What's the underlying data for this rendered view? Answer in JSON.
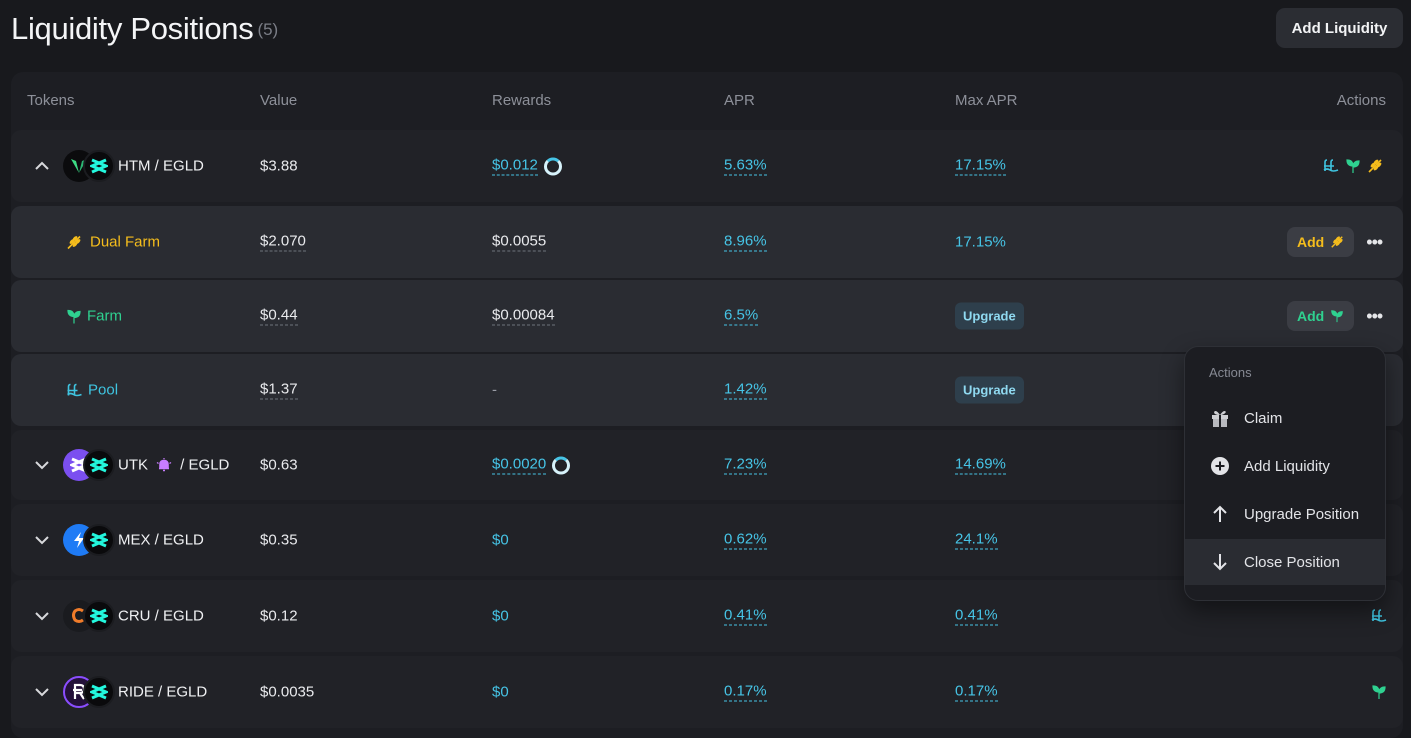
{
  "header": {
    "title": "Liquidity Positions",
    "count": "(5)",
    "add_liquidity": "Add Liquidity"
  },
  "columns": {
    "tokens": "Tokens",
    "value": "Value",
    "rewards": "Rewards",
    "apr": "APR",
    "max_apr": "Max APR",
    "actions": "Actions"
  },
  "rows": [
    {
      "pair_a": "HTM",
      "pair_sep": " / ",
      "pair_b": "EGLD",
      "value": "$3.88",
      "rewards": "$0.012",
      "apr": "5.63%",
      "max_apr": "17.15%",
      "expanded": true
    },
    {
      "pair_a": "UTK",
      "pair_sep": " / ",
      "pair_b": "EGLD",
      "value": "$0.63",
      "rewards": "$0.0020",
      "apr": "7.23%",
      "max_apr": "14.69%"
    },
    {
      "pair_a": "MEX",
      "pair_sep": " / ",
      "pair_b": "EGLD",
      "value": "$0.35",
      "rewards": "$0",
      "apr": "0.62%",
      "max_apr": "24.1%"
    },
    {
      "pair_a": "CRU",
      "pair_sep": " / ",
      "pair_b": "EGLD",
      "value": "$0.12",
      "rewards": "$0",
      "apr": "0.41%",
      "max_apr": "0.41%"
    },
    {
      "pair_a": "RIDE",
      "pair_sep": " / ",
      "pair_b": "EGLD",
      "value": "$0.0035",
      "rewards": "$0",
      "apr": "0.17%",
      "max_apr": "0.17%"
    }
  ],
  "sub_rows": [
    {
      "name": "Dual Farm",
      "value": "$2.070",
      "rewards": "$0.0055",
      "apr": "8.96%",
      "max_apr": "17.15%",
      "add": "Add"
    },
    {
      "name": "Farm",
      "value": "$0.44",
      "rewards": "$0.00084",
      "apr": "6.5%",
      "upgrade": "Upgrade",
      "add": "Add"
    },
    {
      "name": "Pool",
      "value": "$1.37",
      "rewards": "-",
      "apr": "1.42%",
      "upgrade": "Upgrade"
    }
  ],
  "menu": {
    "title": "Actions",
    "items": [
      "Claim",
      "Add Liquidity",
      "Upgrade Position",
      "Close Position"
    ]
  },
  "colors": {
    "accent_blue": "#46c4e6",
    "farm_green": "#2fd190",
    "dual_yellow": "#f5bd1c",
    "pool_cyan": "#3fc4e0",
    "background": "#18191d"
  }
}
